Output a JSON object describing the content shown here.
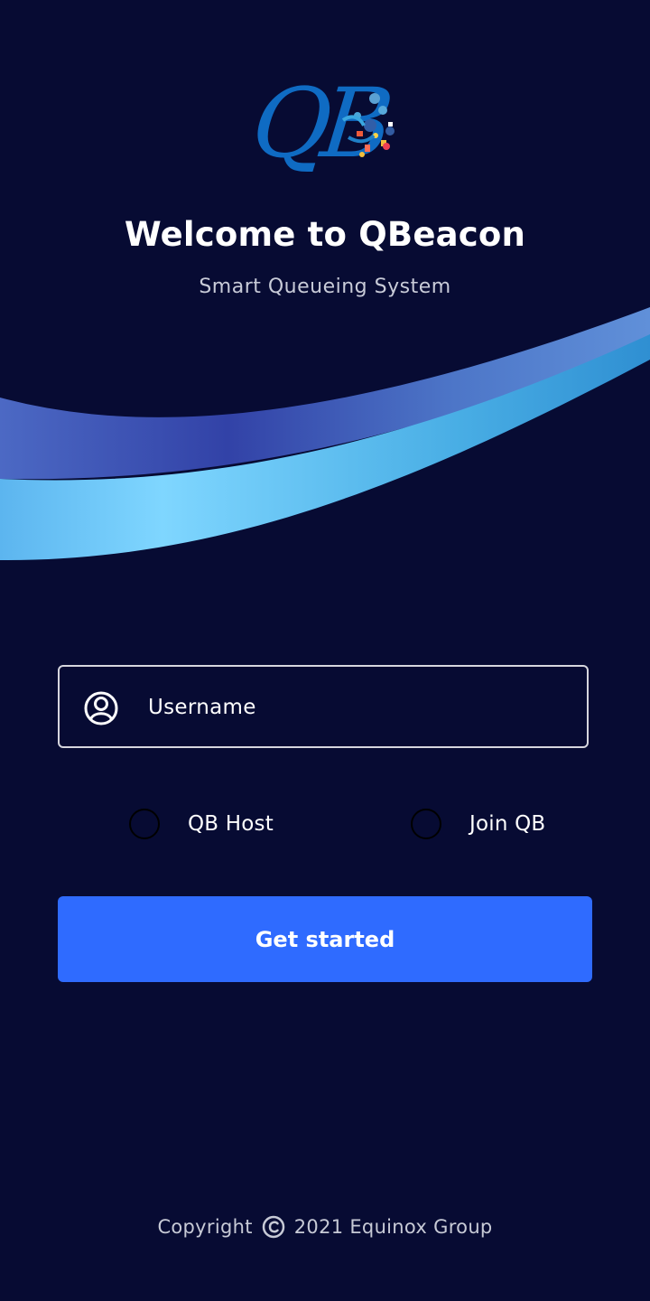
{
  "app": {
    "logo_text": "QB",
    "title": "Welcome to QBeacon",
    "subtitle": "Smart Queueing System"
  },
  "form": {
    "username_placeholder": "Username",
    "username_value": "",
    "radio_options": [
      {
        "label": "QB Host",
        "selected": false
      },
      {
        "label": "Join QB",
        "selected": false
      }
    ],
    "submit_label": "Get started"
  },
  "footer": {
    "copyright_prefix": "Copyright",
    "copyright_icon": "copyright-icon",
    "copyright_text": "2021 Equinox Group"
  },
  "colors": {
    "background": "#070b33",
    "primary": "#2f6bff",
    "logo_blue": "#0f6bc3",
    "wave_light": "#74cdfb",
    "wave_dark": "#3b4fb5"
  },
  "icons": [
    "logo-icon",
    "user-icon",
    "copyright-icon"
  ]
}
